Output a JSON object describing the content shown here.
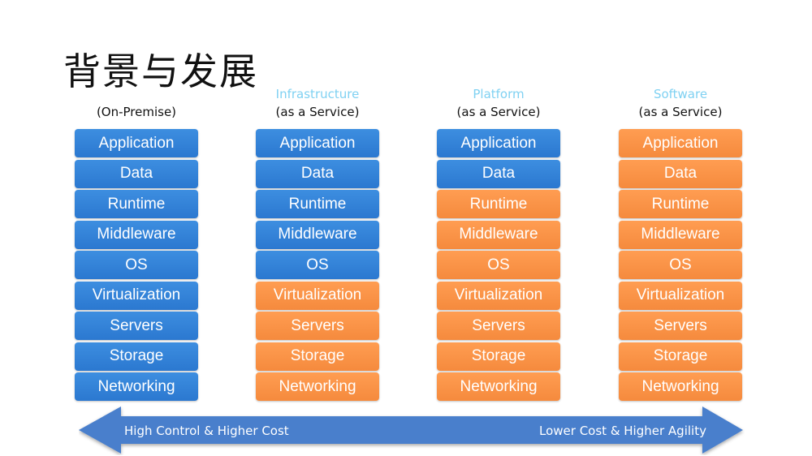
{
  "title": "背景与发展",
  "colors": {
    "managed": "#2f7fd4",
    "vendor": "#f7913f",
    "arrow": "#4a7fcc",
    "header_accent": "#7fd1f2"
  },
  "columns": [
    {
      "top_label": "",
      "sub_label": "(On-Premise)",
      "layers": [
        {
          "label": "Application",
          "managed_by": "you"
        },
        {
          "label": "Data",
          "managed_by": "you"
        },
        {
          "label": "Runtime",
          "managed_by": "you"
        },
        {
          "label": "Middleware",
          "managed_by": "you"
        },
        {
          "label": "OS",
          "managed_by": "you"
        },
        {
          "label": "Virtualization",
          "managed_by": "you"
        },
        {
          "label": "Servers",
          "managed_by": "you"
        },
        {
          "label": "Storage",
          "managed_by": "you"
        },
        {
          "label": "Networking",
          "managed_by": "you"
        }
      ]
    },
    {
      "top_label": "Infrastructure",
      "sub_label": "(as a Service)",
      "layers": [
        {
          "label": "Application",
          "managed_by": "you"
        },
        {
          "label": "Data",
          "managed_by": "you"
        },
        {
          "label": "Runtime",
          "managed_by": "you"
        },
        {
          "label": "Middleware",
          "managed_by": "you"
        },
        {
          "label": "OS",
          "managed_by": "you"
        },
        {
          "label": "Virtualization",
          "managed_by": "vendor"
        },
        {
          "label": "Servers",
          "managed_by": "vendor"
        },
        {
          "label": "Storage",
          "managed_by": "vendor"
        },
        {
          "label": "Networking",
          "managed_by": "vendor"
        }
      ]
    },
    {
      "top_label": "Platform",
      "sub_label": "(as a Service)",
      "layers": [
        {
          "label": "Application",
          "managed_by": "you"
        },
        {
          "label": "Data",
          "managed_by": "you"
        },
        {
          "label": "Runtime",
          "managed_by": "vendor"
        },
        {
          "label": "Middleware",
          "managed_by": "vendor"
        },
        {
          "label": "OS",
          "managed_by": "vendor"
        },
        {
          "label": "Virtualization",
          "managed_by": "vendor"
        },
        {
          "label": "Servers",
          "managed_by": "vendor"
        },
        {
          "label": "Storage",
          "managed_by": "vendor"
        },
        {
          "label": "Networking",
          "managed_by": "vendor"
        }
      ]
    },
    {
      "top_label": "Software",
      "sub_label": "(as a Service)",
      "layers": [
        {
          "label": "Application",
          "managed_by": "vendor"
        },
        {
          "label": "Data",
          "managed_by": "vendor"
        },
        {
          "label": "Runtime",
          "managed_by": "vendor"
        },
        {
          "label": "Middleware",
          "managed_by": "vendor"
        },
        {
          "label": "OS",
          "managed_by": "vendor"
        },
        {
          "label": "Virtualization",
          "managed_by": "vendor"
        },
        {
          "label": "Servers",
          "managed_by": "vendor"
        },
        {
          "label": "Storage",
          "managed_by": "vendor"
        },
        {
          "label": "Networking",
          "managed_by": "vendor"
        }
      ]
    }
  ],
  "arrow": {
    "left_label": "High Control & Higher Cost",
    "right_label": "Lower Cost & Higher Agility"
  }
}
